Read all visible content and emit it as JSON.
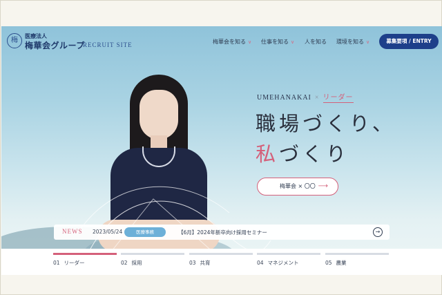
{
  "header": {
    "logo_sub": "医療法人",
    "logo_main": "梅華会グループ",
    "logo_mark": "梅",
    "site_label": "RECRUIT SITE",
    "nav": [
      {
        "label": "梅華会を知る",
        "has_dropdown": true
      },
      {
        "label": "仕事を知る",
        "has_dropdown": true
      },
      {
        "label": "人を知る",
        "has_dropdown": false
      },
      {
        "label": "環境を知る",
        "has_dropdown": true
      }
    ],
    "entry_label": "募集要項 / ENTRY"
  },
  "hero": {
    "brand": "UMEHANAKAI",
    "times": "×",
    "role": "リーダー",
    "headline_line1": "職場づくり、",
    "headline_accent": "私",
    "headline_line2_rest": "づくり",
    "cta_label": "梅華会 × 〇〇"
  },
  "news": {
    "label": "NEWS",
    "date": "2023/05/24",
    "tag": "医療事務",
    "title": "【6月】2024年新卒向け採用セミナー"
  },
  "tabs": [
    {
      "num": "01",
      "label": "リーダー",
      "active": true
    },
    {
      "num": "02",
      "label": "採用",
      "active": false
    },
    {
      "num": "03",
      "label": "共育",
      "active": false
    },
    {
      "num": "04",
      "label": "マネジメント",
      "active": false
    },
    {
      "num": "05",
      "label": "農業",
      "active": false
    }
  ],
  "colors": {
    "accent": "#d4607a",
    "brand_navy": "#1d3f8a",
    "news_tag": "#6db0d8"
  }
}
